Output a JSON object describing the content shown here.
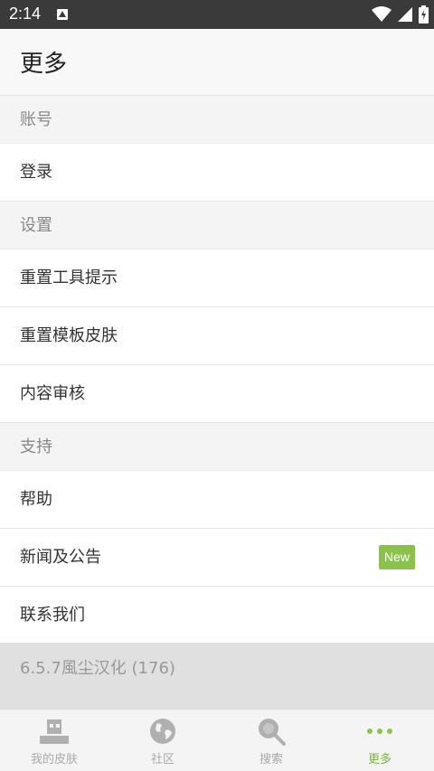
{
  "status_bar": {
    "time": "2:14",
    "app_icon": "a-icon",
    "icons": [
      "wifi-icon",
      "signal-icon",
      "battery-icon"
    ]
  },
  "header": {
    "title": "更多"
  },
  "sections": [
    {
      "title": "账号",
      "items": [
        {
          "label": "登录"
        }
      ]
    },
    {
      "title": "设置",
      "items": [
        {
          "label": "重置工具提示"
        },
        {
          "label": "重置模板皮肤"
        },
        {
          "label": "内容审核"
        }
      ]
    },
    {
      "title": "支持",
      "items": [
        {
          "label": "帮助"
        },
        {
          "label": "新闻及公告",
          "badge": "New"
        },
        {
          "label": "联系我们"
        }
      ]
    }
  ],
  "version": "6.5.7風尘汉化 (176)",
  "bottom_nav": [
    {
      "label": "我的皮肤",
      "icon": "skin-icon"
    },
    {
      "label": "社区",
      "icon": "globe-icon"
    },
    {
      "label": "搜索",
      "icon": "search-icon"
    },
    {
      "label": "更多",
      "icon": "more-dots-icon",
      "active": true
    }
  ],
  "colors": {
    "accent": "#8bc34a",
    "statusbar": "#3a3a3a",
    "section_bg": "#f4f4f4",
    "version_bg": "#e0e0e0"
  }
}
